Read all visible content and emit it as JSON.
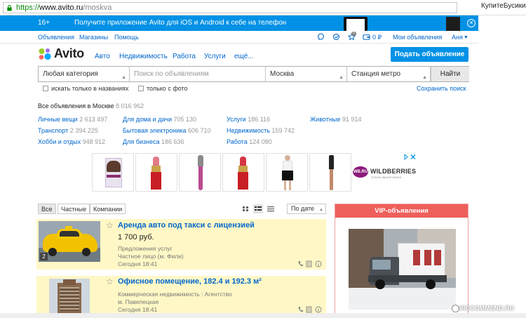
{
  "browser": {
    "url_scheme": "https://",
    "url_host": "www.avito.ru",
    "url_path": "/moskva",
    "top_right_text": "КупитеБусики"
  },
  "app_banner": {
    "age": "16+",
    "text": "Получите приложение Avito для iOS и Android к себе на телефон"
  },
  "top_nav": {
    "left": [
      "Объявления",
      "Магазины",
      "Помощь"
    ],
    "balance": "0 ₽",
    "my_ads": "Мои объявления",
    "user": "Аня",
    "fav_count": "0"
  },
  "header": {
    "logo": "Avito",
    "nav": [
      "Авто",
      "Недвижимость",
      "Работа",
      "Услуги",
      "ещё..."
    ],
    "post_button": "Подать объявление"
  },
  "search": {
    "category": "Любая категория",
    "query_placeholder": "Поиск по объявлениям",
    "city": "Москва",
    "metro": "Станция метро",
    "find_button": "Найти",
    "only_titles": "искать только в названиях",
    "only_photo": "только с фото",
    "save_search": "Сохранить поиск"
  },
  "all_ads": {
    "title": "Все объявления в Москве",
    "count": "8 016 962",
    "categories": [
      {
        "name": "Личные вещи",
        "count": "2 613 497"
      },
      {
        "name": "Для дома и дачи",
        "count": "705 130"
      },
      {
        "name": "Услуги",
        "count": "186 116"
      },
      {
        "name": "Животные",
        "count": "91 914"
      },
      {
        "name": "Транспорт",
        "count": "2 394 225"
      },
      {
        "name": "Бытовая электроника",
        "count": "606 710"
      },
      {
        "name": "Недвижимость",
        "count": "159 742"
      },
      {
        "name": "Хобби и отдых",
        "count": "948 912"
      },
      {
        "name": "Для бизнеса",
        "count": "186 636"
      },
      {
        "name": "Работа",
        "count": "124 080"
      }
    ]
  },
  "ad_banner": {
    "brand": "WILDBERRIES",
    "brand_badge": "WB.RU",
    "brand_sub": "Стиль вашей жизни"
  },
  "filters": {
    "tabs": [
      "Все",
      "Частные",
      "Компании"
    ],
    "sort": "По дате"
  },
  "listings": [
    {
      "title": "Аренда авто под такси с лицензией",
      "price": "1 700 руб.",
      "meta1": "Предложения услуг",
      "meta2": "Частное лицо (м. Фили)",
      "date": "Сегодня 18:41",
      "photo_count": "2"
    },
    {
      "title": "Офисное помещение, 182.4 и 192.3 м²",
      "price": "",
      "meta1": "Коммерческая недвижимость",
      "meta1b": "Агентство",
      "meta2": "м. Павелецкая",
      "date": "Сегодня 18:41"
    }
  ],
  "vip": {
    "title": "VIP-объявления"
  },
  "watermark": "iRECOMMEND.RU",
  "colors": {
    "accent_blue": "#0091e6",
    "link": "#0066cc",
    "vip_red": "#ee5f5b",
    "highlight_yellow": "#fff8c6"
  }
}
